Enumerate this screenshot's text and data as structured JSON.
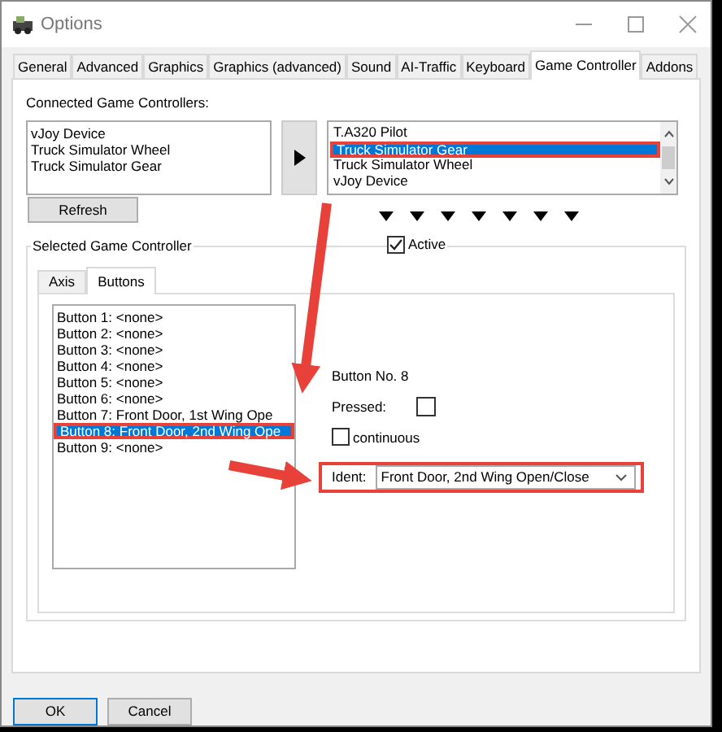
{
  "window": {
    "title": "Options"
  },
  "tabs": [
    {
      "label": "General",
      "selected": false
    },
    {
      "label": "Advanced",
      "selected": false
    },
    {
      "label": "Graphics",
      "selected": false
    },
    {
      "label": "Graphics (advanced)",
      "selected": false
    },
    {
      "label": "Sound",
      "selected": false
    },
    {
      "label": "AI-Traffic",
      "selected": false
    },
    {
      "label": "Keyboard",
      "selected": false
    },
    {
      "label": "Game Controller",
      "selected": true
    },
    {
      "label": "Addons",
      "selected": false
    }
  ],
  "connected": {
    "label": "Connected Game Controllers:",
    "devices": [
      "vJoy Device",
      "Truck Simulator Wheel",
      "Truck Simulator Gear"
    ],
    "refresh": "Refresh"
  },
  "assigned": [
    {
      "text": "T.A320 Pilot",
      "selected": false,
      "annotated": false
    },
    {
      "text": "Truck Simulator Gear",
      "selected": true,
      "annotated": true
    },
    {
      "text": "Truck Simulator Wheel",
      "selected": false,
      "annotated": false
    },
    {
      "text": "vJoy Device",
      "selected": false,
      "annotated": false
    }
  ],
  "selected_controller": {
    "title": "Selected Game Controller",
    "active": {
      "label": "Active",
      "checked": true
    },
    "tabs": [
      {
        "label": "Axis",
        "selected": false
      },
      {
        "label": "Buttons",
        "selected": true
      }
    ],
    "buttons": [
      {
        "text": "Button 1: <none>",
        "selected": false,
        "annotated": false
      },
      {
        "text": "Button 2: <none>",
        "selected": false,
        "annotated": false
      },
      {
        "text": "Button 3: <none>",
        "selected": false,
        "annotated": false
      },
      {
        "text": "Button 4: <none>",
        "selected": false,
        "annotated": false
      },
      {
        "text": "Button 5: <none>",
        "selected": false,
        "annotated": false
      },
      {
        "text": "Button 6: <none>",
        "selected": false,
        "annotated": false
      },
      {
        "text": "Button 7: Front Door, 1st Wing Ope",
        "selected": false,
        "annotated": false
      },
      {
        "text": "Button 8: Front Door, 2nd Wing Ope",
        "selected": true,
        "annotated": true
      },
      {
        "text": "Button 9: <none>",
        "selected": false,
        "annotated": false
      }
    ],
    "detail": {
      "button_no": "Button No. 8",
      "pressed_label": "Pressed:",
      "pressed": false,
      "continuous": {
        "label": "continuous",
        "checked": false
      },
      "ident": {
        "label": "Ident:",
        "value": "Front Door, 2nd Wing Open/Close",
        "annotated": true
      }
    }
  },
  "footer": [
    {
      "label": "OK",
      "default": true
    },
    {
      "label": "Cancel",
      "default": false
    }
  ]
}
